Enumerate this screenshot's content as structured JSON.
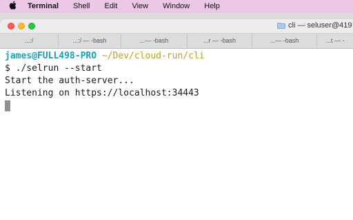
{
  "menubar": {
    "apple_icon": "apple-logo-icon",
    "items": [
      "Terminal",
      "Shell",
      "Edit",
      "View",
      "Window",
      "Help"
    ]
  },
  "window": {
    "title": "cli — seluser@419",
    "title_icon": "folder-icon"
  },
  "tabs": [
    {
      "label": "...:/"
    },
    {
      "label": "...:/ — -bash"
    },
    {
      "label": "...— -bash"
    },
    {
      "label": "...r — -bash"
    },
    {
      "label": "...— -bash"
    },
    {
      "label": "...t — -"
    }
  ],
  "terminal": {
    "prompt_user": "james@FULL498-PRO",
    "prompt_path": "~/Dev/cloud-run/cli",
    "lines": [
      "$ ./selrun --start",
      "Start the auth-server...",
      "Listening on https://localhost:34443"
    ]
  },
  "colors": {
    "menubar_bg": "#ecc7e6",
    "prompt_user": "#1a9fb8",
    "prompt_path": "#b4a12a",
    "close": "#fe5f57",
    "minimize": "#febc2e",
    "maximize": "#28c840"
  }
}
